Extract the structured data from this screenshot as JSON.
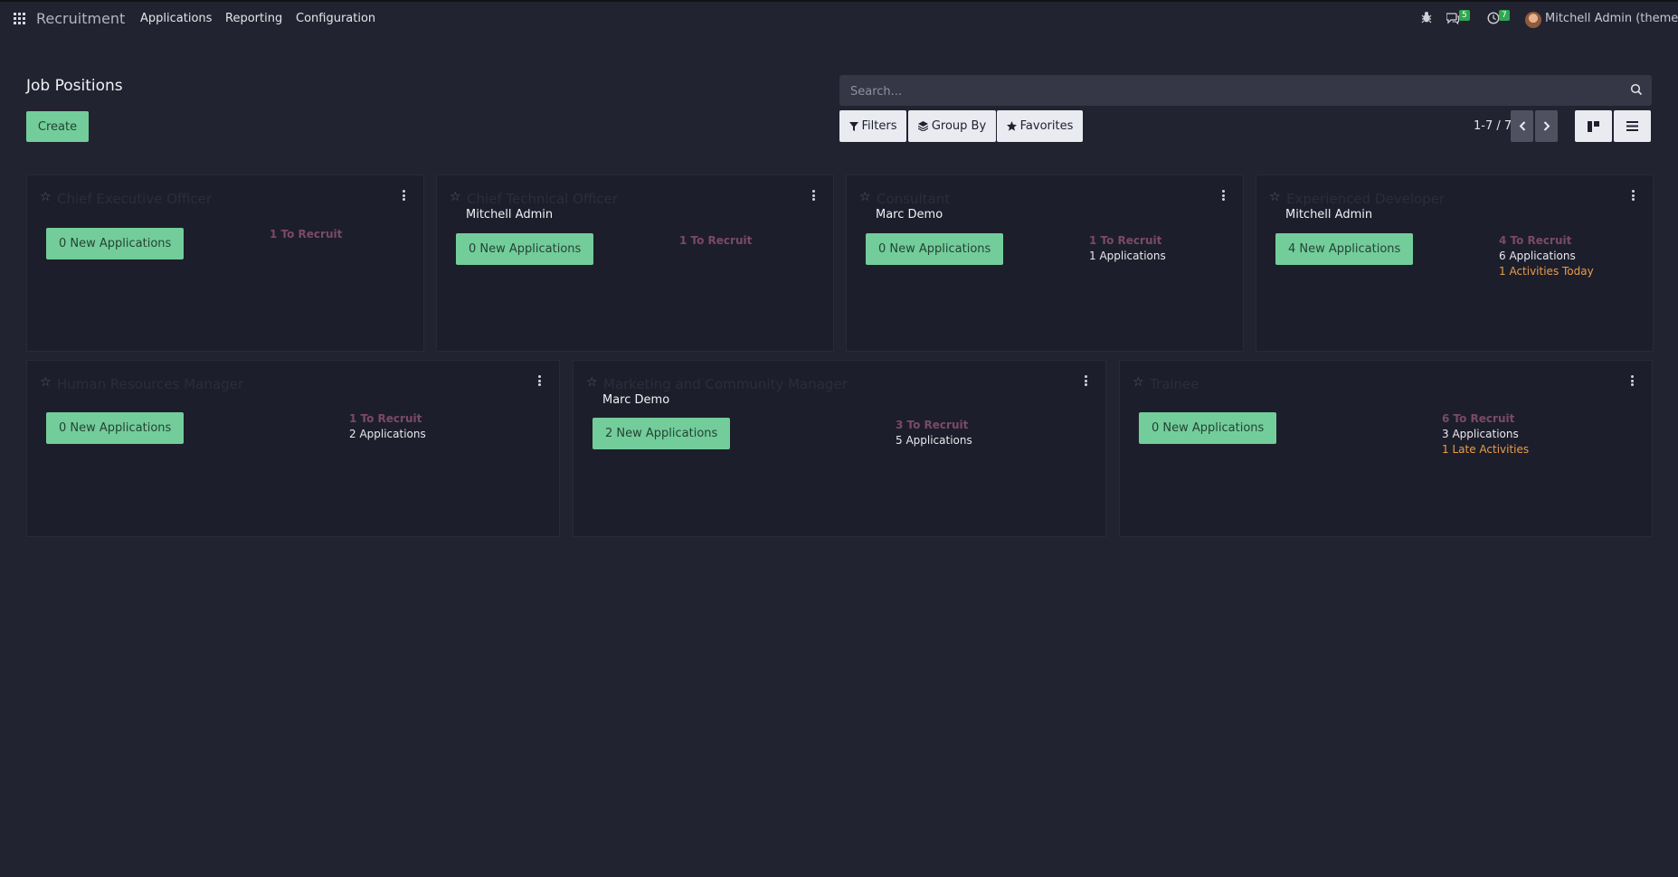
{
  "topbar": {
    "brand": "Recruitment",
    "menu": [
      "Applications",
      "Reporting",
      "Configuration"
    ],
    "messages_count": "5",
    "activities_count": "7",
    "user": "Mitchell Admin (theme)"
  },
  "page": {
    "title": "Job Positions",
    "create_label": "Create"
  },
  "search": {
    "placeholder": "Search..."
  },
  "filters": {
    "filters_label": "Filters",
    "groupby_label": "Group By",
    "favorites_label": "Favorites"
  },
  "pager": {
    "text": "1-7 / 7"
  },
  "jobs": [
    {
      "title": "Chief Executive Officer",
      "manager": "",
      "new_apps": "0 New Applications",
      "to_recruit": "1 To Recruit",
      "applications": "",
      "activity": ""
    },
    {
      "title": "Chief Technical Officer",
      "manager": "Mitchell Admin",
      "new_apps": "0 New Applications",
      "to_recruit": "1 To Recruit",
      "applications": "",
      "activity": ""
    },
    {
      "title": "Consultant",
      "manager": "Marc Demo",
      "new_apps": "0 New Applications",
      "to_recruit": "1 To Recruit",
      "applications": "1 Applications",
      "activity": ""
    },
    {
      "title": "Experienced Developer",
      "manager": "Mitchell Admin",
      "new_apps": "4 New Applications",
      "to_recruit": "4 To Recruit",
      "applications": "6 Applications",
      "activity": "1 Activities Today"
    },
    {
      "title": "Human Resources Manager",
      "manager": "",
      "new_apps": "0 New Applications",
      "to_recruit": "1 To Recruit",
      "applications": "2 Applications",
      "activity": ""
    },
    {
      "title": "Marketing and Community Manager",
      "manager": "Marc Demo",
      "new_apps": "2 New Applications",
      "to_recruit": "3 To Recruit",
      "applications": "5 Applications",
      "activity": ""
    },
    {
      "title": "Trainee",
      "manager": "",
      "new_apps": "0 New Applications",
      "to_recruit": "6 To Recruit",
      "applications": "3 Applications",
      "activity": "1 Late Activities"
    }
  ]
}
